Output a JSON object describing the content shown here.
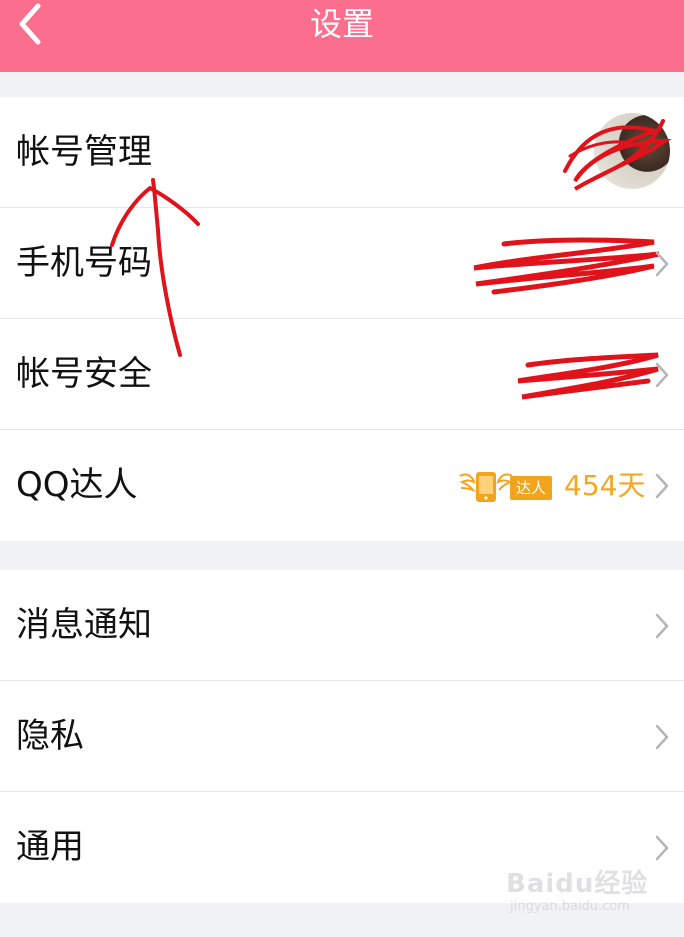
{
  "header": {
    "title": "设置",
    "background": "#fb6e8e"
  },
  "group1": {
    "rows": [
      {
        "label": "帐号管理"
      },
      {
        "label": "手机号码"
      },
      {
        "label": "帐号安全"
      },
      {
        "label": "QQ达人",
        "badge_text": "达人",
        "days": "454天"
      }
    ]
  },
  "group2": {
    "rows": [
      {
        "label": "消息通知"
      },
      {
        "label": "隐私"
      },
      {
        "label": "通用"
      }
    ]
  },
  "icons": [
    "back-arrow-icon",
    "chevron-right-icon",
    "avatar",
    "qq-talent-badge-icon"
  ],
  "annotation_color": "#e0121a",
  "accent_orange": "#f5a623",
  "watermark": {
    "logo": "Baidu经验",
    "url": "jingyan.baidu.com"
  }
}
